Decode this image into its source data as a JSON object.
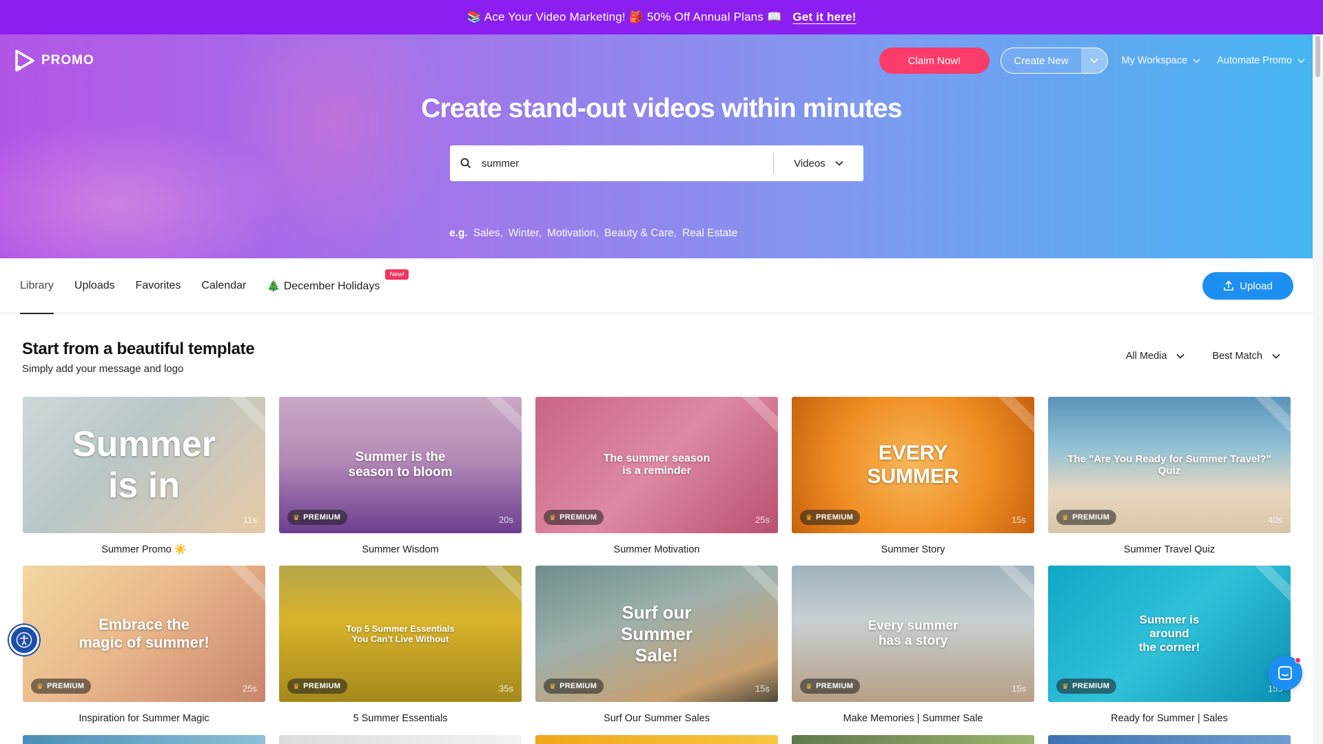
{
  "announcement": {
    "text": "📚 Ace Your Video Marketing! 🎒 50% Off Annual Plans 📖",
    "cta": "Get it here!"
  },
  "brand": {
    "name": "PROMO"
  },
  "topnav": {
    "claim": "Claim Now!",
    "create": "Create New",
    "workspace": "My Workspace",
    "automate": "Automate Promo"
  },
  "hero": {
    "title": "Create stand-out videos within minutes",
    "search_value": "summer",
    "search_type": "Videos",
    "examples_label": "e.g.",
    "examples": [
      "Sales,",
      "Winter,",
      "Motivation,",
      "Beauty & Care,",
      "Real Estate"
    ]
  },
  "tabs": {
    "library": "Library",
    "uploads": "Uploads",
    "favorites": "Favorites",
    "calendar": "Calendar",
    "holidays": "🎄 December Holidays",
    "new_badge": "New!",
    "upload": "Upload"
  },
  "section": {
    "title": "Start from a beautiful template",
    "subtitle": "Simply add your message and logo",
    "filter_media": "All Media",
    "filter_sort": "Best Match"
  },
  "premium_label": "PREMIUM",
  "templates": [
    {
      "title": "Summer Promo ☀️",
      "overlay": "Summer\nis in",
      "duration": "11s",
      "premium": false,
      "bg": "linear-gradient(135deg,#cfd7d8 0%,#b9c7c9 40%,#e8c9a6 100%)",
      "fs": 52
    },
    {
      "title": "Summer Wisdom",
      "overlay": "Summer is the\nseason to bloom",
      "duration": "20s",
      "premium": true,
      "bg": "linear-gradient(180deg,#c9a7c4 0%,#b48bb6 45%,#6d3e8f 100%)",
      "fs": 19
    },
    {
      "title": "Summer Motivation",
      "overlay": "The summer season\nis a reminder",
      "duration": "25s",
      "premium": true,
      "bg": "linear-gradient(135deg,#c96584 0%,#de8aa2 50%,#b8506e 100%)",
      "fs": 16
    },
    {
      "title": "Summer Story",
      "overlay": "EVERY\nSUMMER",
      "duration": "15s",
      "premium": true,
      "bg": "radial-gradient(circle at 50% 50%,#f7b85a 0%,#ef8d22 55%,#c9610e 100%)",
      "fs": 30
    },
    {
      "title": "Summer Travel Quiz",
      "overlay": "The \"Are You Ready for Summer Travel?\" Quiz",
      "duration": "40s",
      "premium": true,
      "bg": "linear-gradient(180deg,#5b93b8 0%,#8dbfd6 35%,#e7d7bf 70%,#d9c6a9 100%)",
      "fs": 15
    },
    {
      "title": "Inspiration for Summer Magic",
      "overlay": "Embrace the\nmagic of summer!",
      "duration": "25s",
      "premium": true,
      "bg": "linear-gradient(135deg,#f2d7a0 0%,#e9b98d 45%,#c9856b 100%)",
      "fs": 22
    },
    {
      "title": "5 Summer Essentials",
      "overlay": "Top 5 Summer Essentials\nYou Can't Live Without",
      "duration": "35s",
      "premium": true,
      "bg": "linear-gradient(180deg,#b5a64a 0%,#d9b32a 40%,#a3891c 100%)",
      "fs": 13
    },
    {
      "title": "Surf Our Summer Sales",
      "overlay": "Surf our\nSummer\nSale!",
      "duration": "15s",
      "premium": true,
      "bg": "linear-gradient(160deg,#6f8f8c 0%,#9db0ad 40%,#c9a070 80%,#4f4a3a 100%)",
      "fs": 26
    },
    {
      "title": "Make Memories | Summer Sale",
      "overlay": "Every summer\nhas a story",
      "duration": "15s",
      "premium": true,
      "bg": "linear-gradient(180deg,#9fb2bf 0%,#c7cfd1 40%,#b79f85 100%)",
      "fs": 19
    },
    {
      "title": "Ready for Summer | Sales",
      "overlay": "Summer is\naround\nthe corner!",
      "duration": "15s",
      "premium": true,
      "bg": "linear-gradient(135deg,#12a7c8 0%,#30c1d9 50%,#0a8fb2 100%)",
      "fs": 17
    }
  ],
  "colors": {
    "announce_bg": "#8a1ff0",
    "claim": "#fb3b6a",
    "upload": "#1d8ff0"
  }
}
